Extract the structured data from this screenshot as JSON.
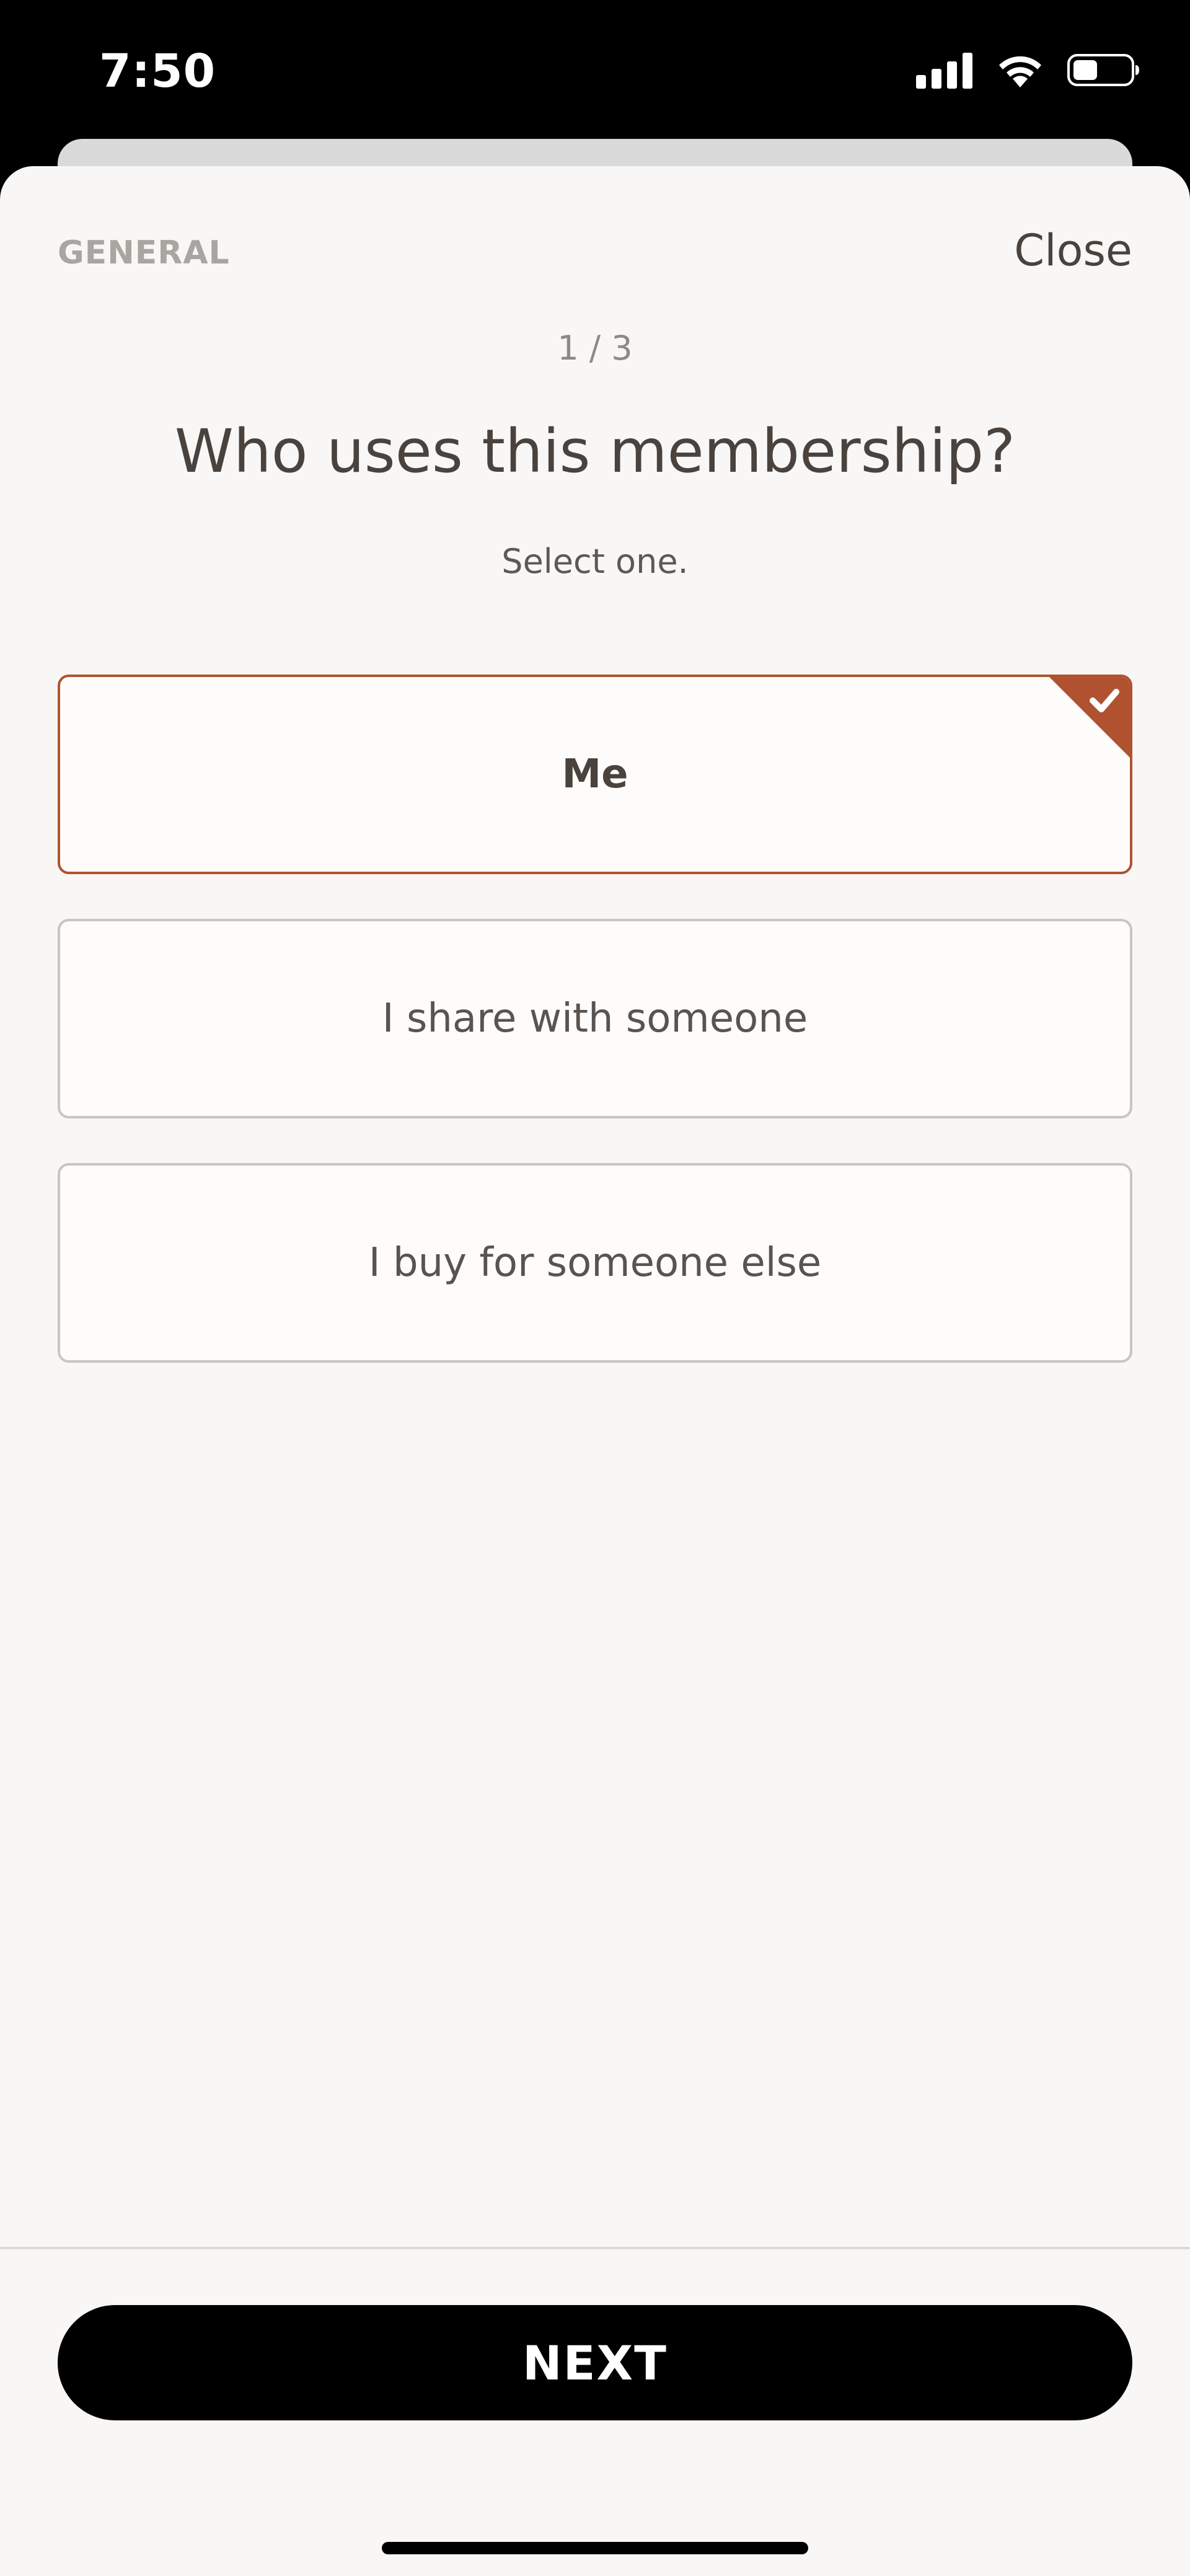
{
  "status_bar": {
    "time": "7:50",
    "icons": [
      "cellular-signal-icon",
      "wifi-icon",
      "battery-icon"
    ]
  },
  "header": {
    "section_label": "GENERAL",
    "close_label": "Close"
  },
  "step": {
    "counter": "1 / 3"
  },
  "question": {
    "title": "Who uses this membership?",
    "instruction": "Select one."
  },
  "options": [
    {
      "label": "Me",
      "selected": true
    },
    {
      "label": "I share with someone",
      "selected": false
    },
    {
      "label": "I buy for someone else",
      "selected": false
    }
  ],
  "footer": {
    "next_label": "NEXT"
  },
  "colors": {
    "accent": "#b0522f",
    "text_primary": "#4a423d",
    "background": "#f8f7f5",
    "button": "#000000"
  }
}
